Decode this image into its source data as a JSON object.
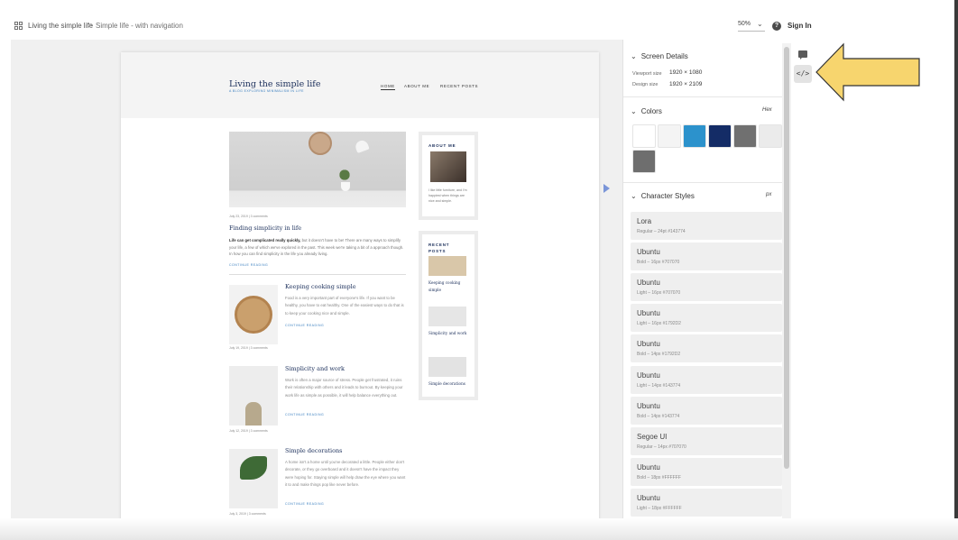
{
  "topbar": {
    "breadcrumb_root": "Living the simple life",
    "breadcrumb_separator": ">",
    "breadcrumb_leaf": "Simple life - with navigation",
    "zoom": "50%",
    "zoom_chevron": "⌄",
    "help": "?",
    "sign_in": "Sign In"
  },
  "site": {
    "title": "Living the simple life",
    "tagline": "A BLOG EXPLORING MINIMALISM IN LIFE",
    "nav": [
      "HOME",
      "ABOUT ME",
      "RECENT POSTS"
    ]
  },
  "posts": {
    "featured": {
      "meta": "July 23, 2019  |  3 comments",
      "title": "Finding simplicity in life",
      "excerpt_bold": "Life can get complicated really quickly,",
      "excerpt_rest": " but it doesn't have to be! There are many ways to simplify your life, a few of which we've explored in the past. This week we're taking a bit of a approach though. In how you can find simplicity in the life you already living.",
      "cta": "CONTINUE READING"
    },
    "list": [
      {
        "title": "Keeping cooking simple",
        "excerpt": "Food is a very important part of everyone's life. If you want to be healthy, you have to eat healthy. One of the easiest ways to do that is to keep your cooking nice and simple.",
        "cta": "CONTINUE READING",
        "meta": "July 19, 2019  |  3 comments"
      },
      {
        "title": "Simplicity and work",
        "excerpt": "Work is often a major source of stress. People get frustrated, it ruins their relationship with others and it leads to burnout. By keeping your work life as simple as possible, it will help balance everything out.",
        "cta": "CONTINUE READING",
        "meta": "July 12, 2019  |  3 comments"
      },
      {
        "title": "Simple decorations",
        "excerpt": "A home isn't a home until you've decorated a little. People either don't decorate, or they go overboard and it doesn't have the impact they were hoping for. Staying simple will help draw the eye where you want it to and make things pop like never before.",
        "cta": "CONTINUE READING",
        "meta": "July 3, 2019  |  3 comments"
      }
    ]
  },
  "sidebar": {
    "about_title": "ABOUT ME",
    "about_text": "I like little furniture, and I'm happiest when things are nice and simple.",
    "recent_title": "RECENT POSTS",
    "recent_items": [
      "Keeping cooking simple",
      "Simplicity and work",
      "Simple decorations"
    ]
  },
  "inspect": {
    "screen_details_title": "Screen Details",
    "viewport_label": "Viewport size",
    "viewport_value": "1920 × 1080",
    "design_label": "Design size",
    "design_value": "1920 × 2109",
    "colors_title": "Colors",
    "colors_unit": "Hex",
    "colors": [
      "#ffffff",
      "#f4f4f4",
      "#2c92cc",
      "#142c66",
      "#707070",
      "#ebebeb",
      "#6e6e6e"
    ],
    "styles_title": "Character Styles",
    "styles_unit": "px",
    "styles": [
      {
        "name": "Lora",
        "spec": "Regular – 24pt #143774"
      },
      {
        "name": "Ubuntu",
        "spec": "Bold – 16px #707070"
      },
      {
        "name": "Ubuntu",
        "spec": "Light – 16px #707070"
      },
      {
        "name": "Ubuntu",
        "spec": "Light – 16px #1792D2"
      },
      {
        "name": "Ubuntu",
        "spec": "Bold – 14px #1792D2"
      },
      {
        "name": "Ubuntu",
        "spec": "Light – 14px #143774"
      },
      {
        "name": "Ubuntu",
        "spec": "Bold – 14px #143774"
      },
      {
        "name": "Segoe UI",
        "spec": "Regular – 14px #707070"
      },
      {
        "name": "Ubuntu",
        "spec": "Bold – 18px #FFFFFF"
      },
      {
        "name": "Ubuntu",
        "spec": "Light – 18px #FFFFFF"
      }
    ]
  },
  "toolbar": {
    "code_icon": "</>"
  },
  "accent": "#f7d56e"
}
